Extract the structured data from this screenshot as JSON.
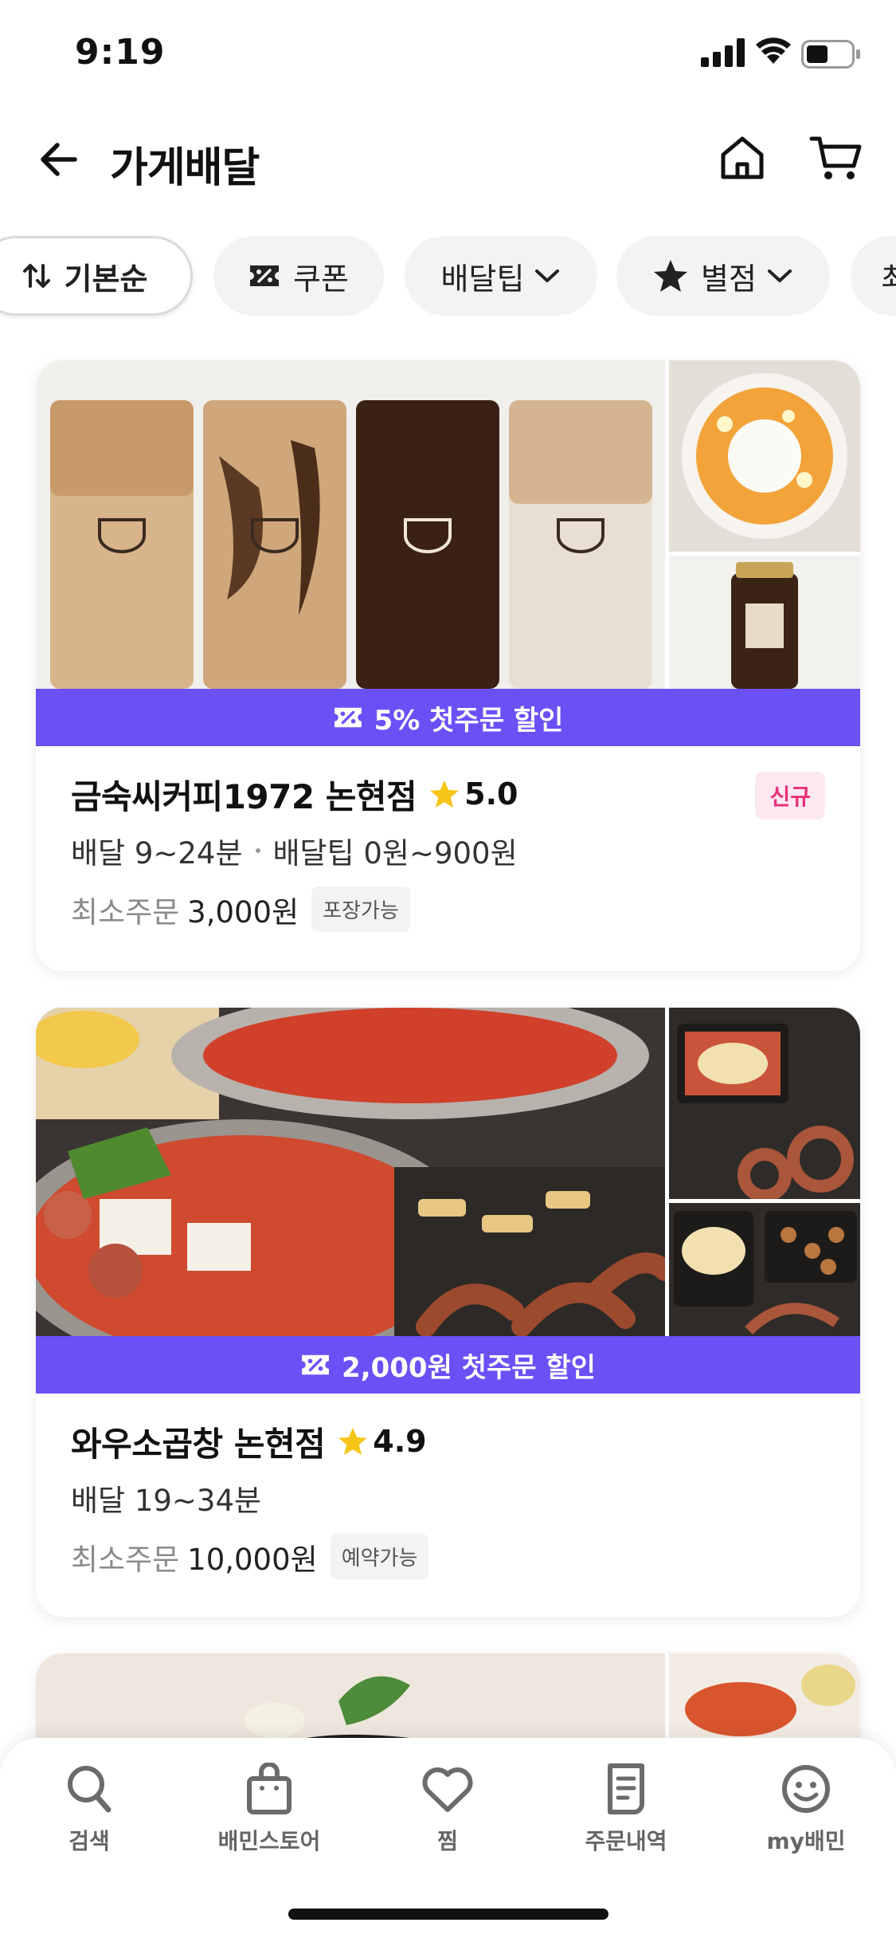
{
  "status_bar": {
    "time": "9:19"
  },
  "header": {
    "title": "가게배달"
  },
  "filters": [
    {
      "label": "기본순",
      "icon": "sort-icon"
    },
    {
      "label": "쿠폰",
      "icon": "coupon-icon"
    },
    {
      "label": "배달팁",
      "icon": "chevron-down-icon"
    },
    {
      "label": "별점",
      "icon": "star-icon"
    },
    {
      "label": "최"
    }
  ],
  "stores": [
    {
      "promo": "5% 첫주문 할인",
      "name": "금숙씨커피1972 논현점",
      "rating": "5.0",
      "badge": "신규",
      "delivery_time": "배달 9~24분",
      "delivery_tip": "배달팁 0원~900원",
      "min_order_label": "최소주문",
      "min_order_value": "3,000원",
      "tag": "포장가능"
    },
    {
      "promo": "2,000원 첫주문 할인",
      "name": "와우소곱창 논현점",
      "rating": "4.9",
      "delivery_time": "배달 19~34분",
      "min_order_label": "최소주문",
      "min_order_value": "10,000원",
      "tag": "예약가능"
    }
  ],
  "tabbar": [
    {
      "label": "검색",
      "icon": "search-icon"
    },
    {
      "label": "배민스토어",
      "icon": "shopping-bag-icon"
    },
    {
      "label": "찜",
      "icon": "heart-icon"
    },
    {
      "label": "주문내역",
      "icon": "receipt-icon"
    },
    {
      "label": "my배민",
      "icon": "smiley-icon"
    }
  ],
  "colors": {
    "accent": "#6b50f6",
    "new_badge": "#e8317a",
    "star": "#f5c518"
  }
}
